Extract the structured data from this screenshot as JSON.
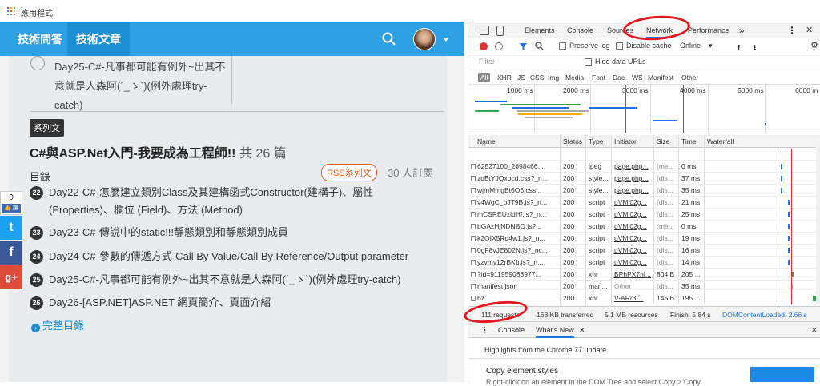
{
  "bookmarks": {
    "apps_label": "應用程式"
  },
  "site": {
    "nav": {
      "qa_tab": "技術問答",
      "article_tab": "技術文章"
    },
    "prev_item": {
      "text": "Day25-C#-凡事都可能有例外~出其不意就是人森阿(´_ゝ`)(例外處理try-catch)"
    },
    "series_badge": "系列文",
    "series_title": "C#與ASP.Net入門-我要成為工程師!!",
    "series_count": "共 26 篇",
    "toc_label": "目錄",
    "rss_label": "RSS系列文",
    "subscribers": "30 人訂閱",
    "items": [
      {
        "num": "22",
        "text": "Day22-C#-怎麼建立類別Class及其建構函式Constructor(建構子)、屬性(Properties)、欄位 (Field)、方法 (Method)"
      },
      {
        "num": "23",
        "text": "Day23-C#-傳說中的static!!!靜態類別和靜態類別成員"
      },
      {
        "num": "24",
        "text": "Day24-C#-參數的傳遞方式-Call By Value/Call By Reference/Output parameter"
      },
      {
        "num": "25",
        "text": "Day25-C#-凡事都可能有例外~出其不意就是人森阿(´_ゝ`)(例外處理try-catch)"
      },
      {
        "num": "26",
        "text": "Day26-[ASP.NET]ASP.NET 網頁簡介、頁面介紹"
      }
    ],
    "full_toc": "完整目錄",
    "social": {
      "fb_count": "0",
      "fb_like": "讚",
      "twitter": "t",
      "facebook": "f",
      "google": "g+"
    }
  },
  "devtools": {
    "tabs": [
      "Elements",
      "Console",
      "Sources",
      "Network",
      "Performance"
    ],
    "more_tabs": "»",
    "toolbar": {
      "preserve_log": "Preserve log",
      "disable_cache": "Disable cache",
      "throttle": "Online"
    },
    "filter_placeholder": "Filter",
    "hide_data_urls": "Hide data URLs",
    "types": [
      "All",
      "XHR",
      "JS",
      "CSS",
      "Img",
      "Media",
      "Font",
      "Doc",
      "WS",
      "Manifest",
      "Other"
    ],
    "overview_ticks": [
      "1000 ms",
      "2000 ms",
      "3000 ms",
      "4000 ms",
      "5000 ms",
      "6000 m"
    ],
    "columns": [
      "Name",
      "Status",
      "Type",
      "Initiator",
      "Size",
      "Time",
      "Waterfall"
    ],
    "rows": [
      {
        "name": "62527100_2698466...",
        "status": "200",
        "type": "jpeg",
        "init": "page.php...",
        "size": "(me...",
        "time": "0 ms"
      },
      {
        "name": "zdBtYJQxocd.css?_n...",
        "status": "200",
        "type": "style...",
        "init": "page.php...",
        "size": "(dis...",
        "time": "37 ms"
      },
      {
        "name": "wjmMmgBt6O6.css...",
        "status": "200",
        "type": "style...",
        "init": "page.php...",
        "size": "(dis...",
        "time": "35 ms"
      },
      {
        "name": "v4WgC_pJT9B.js?_n...",
        "status": "200",
        "type": "script",
        "init": "uVMl02g...",
        "size": "(dis...",
        "time": "21 ms"
      },
      {
        "name": "mCSREUzldHf.js?_n...",
        "status": "200",
        "type": "script",
        "init": "uVMl02g...",
        "size": "(dis...",
        "time": "25 ms"
      },
      {
        "name": "bGAzHjNDNBO.js?...",
        "status": "200",
        "type": "script",
        "init": "uVMl02g...",
        "size": "(me...",
        "time": "0 ms"
      },
      {
        "name": "k2OIX5Rq4w1.js?_n...",
        "status": "200",
        "type": "script",
        "init": "uVMl02g...",
        "size": "(dis...",
        "time": "19 ms"
      },
      {
        "name": "0gF8vJE802N.js?_nc...",
        "status": "200",
        "type": "script",
        "init": "uVMl02g...",
        "size": "(dis...",
        "time": "16 ms"
      },
      {
        "name": "yzvmy12rBKb.js?_n...",
        "status": "200",
        "type": "script",
        "init": "uVMl02g...",
        "size": "(dis...",
        "time": "14 ms"
      },
      {
        "name": "?id=911959088977...",
        "status": "200",
        "type": "xhr",
        "init": "BPhPX7nl...",
        "size": "804 B",
        "time": "205 ..."
      },
      {
        "name": "manifest.json",
        "status": "200",
        "type": "man...",
        "init": "Other",
        "size": "(dis...",
        "time": "35 ms"
      },
      {
        "name": "bz",
        "status": "200",
        "type": "xhr",
        "init": "V-ARr3l...",
        "size": "145 B",
        "time": "195 ..."
      }
    ],
    "status_bar": {
      "requests": "111 requests",
      "transferred": "168 KB transferred",
      "resources": "5.1 MB resources",
      "finish": "Finish: 5.84 s",
      "dcl": "DOMContentLoaded: 2.66 s"
    },
    "drawer_tabs": {
      "console": "Console",
      "whatsnew": "What's New"
    },
    "highlights": "Highlights from the Chrome 77 update",
    "copy_styles": "Copy element styles",
    "copy_styles_desc": "Right-click on an element in the DOM Tree and select Copy > Copy"
  },
  "colors": {
    "accent": "#2ea1e5",
    "annotation": "#e5161d"
  }
}
